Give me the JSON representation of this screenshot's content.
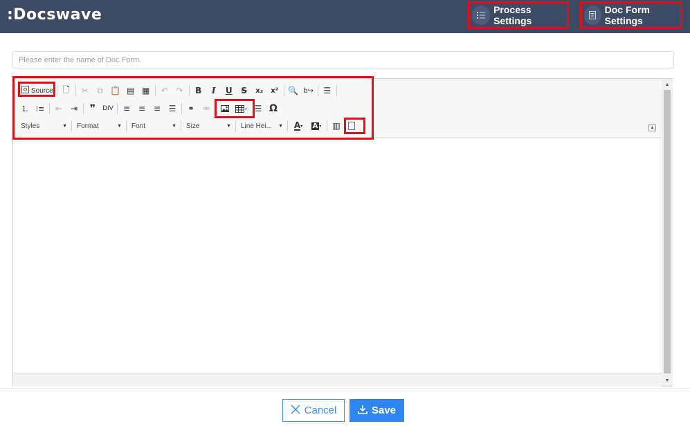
{
  "app": {
    "logo_text": ":Docswave"
  },
  "header": {
    "process_settings_label": "Process Settings",
    "doc_form_settings_label": "Doc Form Settings"
  },
  "form": {
    "name_placeholder": "Please enter the name of Doc Form."
  },
  "editor": {
    "source_label": "Source",
    "combos": {
      "styles": "Styles",
      "format": "Format",
      "font": "Font",
      "size": "Size",
      "line_height": "Line Hei..."
    }
  },
  "footer": {
    "cancel_label": "Cancel",
    "save_label": "Save"
  },
  "colors": {
    "header_bg": "#3d4a63",
    "accent": "#2f86f0",
    "highlight": "#e0101b"
  },
  "icons": [
    "list-icon",
    "document-icon",
    "source-icon",
    "preview-icon",
    "cut-icon",
    "copy-icon",
    "paste-icon",
    "paste-text-icon",
    "paste-word-icon",
    "undo-icon",
    "redo-icon",
    "bold-icon",
    "italic-icon",
    "underline-icon",
    "strike-icon",
    "subscript-icon",
    "superscript-icon",
    "find-icon",
    "replace-icon",
    "page-break-icon",
    "numbered-list-icon",
    "bulleted-list-icon",
    "outdent-icon",
    "indent-icon",
    "blockquote-icon",
    "div-icon",
    "align-left-icon",
    "align-center-icon",
    "align-right-icon",
    "justify-icon",
    "link-icon",
    "unlink-icon",
    "image-icon",
    "table-icon",
    "horizontal-line-icon",
    "special-char-icon",
    "text-color-icon",
    "bg-color-icon",
    "show-blocks-icon",
    "maximize-icon",
    "x-icon",
    "download-icon"
  ]
}
